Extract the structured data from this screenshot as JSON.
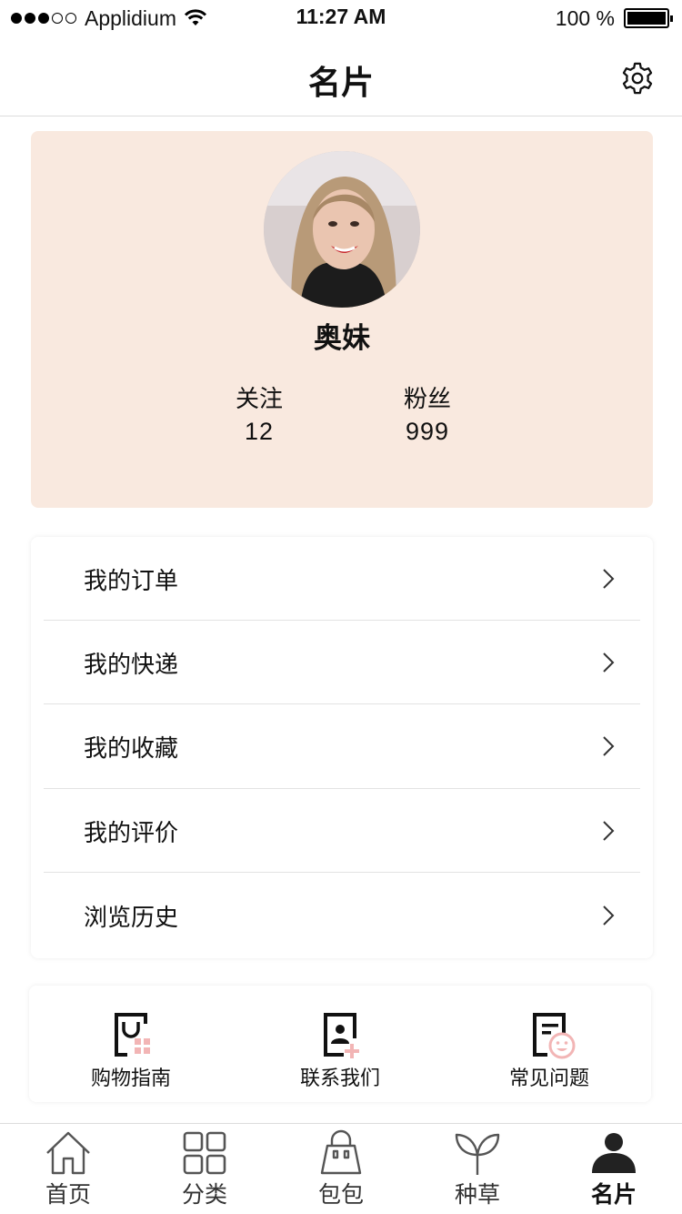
{
  "status_bar": {
    "carrier": "Applidium",
    "time": "11:27 AM",
    "battery": "100 %"
  },
  "nav": {
    "title": "名片"
  },
  "profile": {
    "name": "奥妹",
    "stats": [
      {
        "label": "关注",
        "value": "12"
      },
      {
        "label": "粉丝",
        "value": "999"
      }
    ]
  },
  "menu": {
    "items": [
      {
        "label": "我的订单"
      },
      {
        "label": "我的快递"
      },
      {
        "label": "我的收藏"
      },
      {
        "label": "我的评价"
      },
      {
        "label": "浏览历史"
      }
    ]
  },
  "services": {
    "items": [
      {
        "label": "购物指南",
        "icon": "shopping-guide-icon"
      },
      {
        "label": "联系我们",
        "icon": "contact-us-icon"
      },
      {
        "label": "常见问题",
        "icon": "faq-icon"
      }
    ]
  },
  "tabs": {
    "items": [
      {
        "label": "首页",
        "icon": "home-icon"
      },
      {
        "label": "分类",
        "icon": "grid-icon"
      },
      {
        "label": "包包",
        "icon": "bag-icon"
      },
      {
        "label": "种草",
        "icon": "sprout-icon"
      },
      {
        "label": "名片",
        "icon": "person-icon",
        "active": true
      }
    ]
  },
  "colors": {
    "profile_bg": "#f9e9df",
    "accent_pink": "#f2b5b5"
  }
}
